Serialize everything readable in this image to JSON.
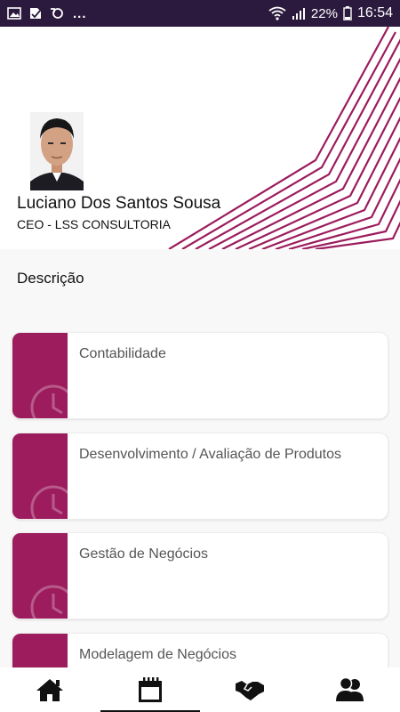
{
  "status_bar": {
    "battery": "22%",
    "time": "16:54",
    "overflow": "..."
  },
  "profile": {
    "name": "Luciano Dos Santos Sousa",
    "role": "CEO - LSS CONSULTORIA"
  },
  "section": {
    "description_label": "Descrição"
  },
  "services": [
    {
      "label": "Contabilidade"
    },
    {
      "label": "Desenvolvimento / Avaliação de Produtos"
    },
    {
      "label": "Gestão de Negócios"
    },
    {
      "label": "Modelagem de Negócios"
    }
  ],
  "bottom_nav": {
    "items": [
      {
        "icon": "home-icon"
      },
      {
        "icon": "calendar-icon",
        "active": true
      },
      {
        "icon": "handshake-icon"
      },
      {
        "icon": "contacts-icon"
      }
    ]
  },
  "colors": {
    "accent": "#9c1c5d",
    "status_bar": "#2b1a3d"
  }
}
